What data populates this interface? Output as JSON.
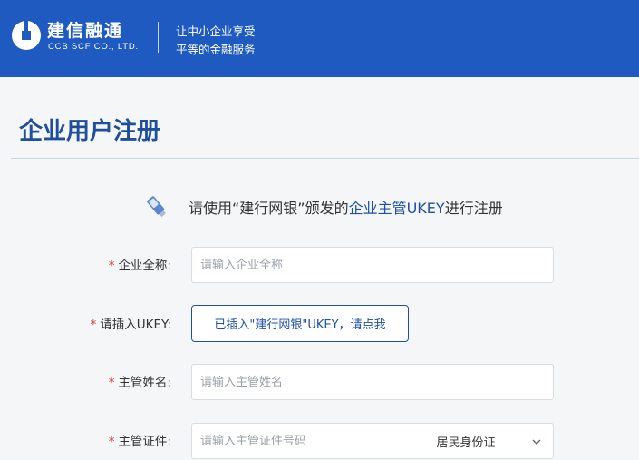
{
  "header": {
    "logo_cn": "建信融通",
    "logo_en": "CCB SCF CO., LTD.",
    "slogan_line1": "让中小企业享受",
    "slogan_line2": "平等的金融服务",
    "background_color": "#1e5ac0"
  },
  "page": {
    "title": "企业用户注册"
  },
  "notice": {
    "icon": "usb-key-icon",
    "prefix": "请使用“建行网银”颁发的",
    "highlight": "企业主管UKEY",
    "suffix": "进行注册"
  },
  "form": {
    "required_mark": "*",
    "company_name": {
      "label": "企业全称:",
      "placeholder": "请输入企业全称",
      "value": ""
    },
    "ukey": {
      "label": "请插入UKEY:",
      "button_label": "已插入\"建行网银\"UKEY，请点我"
    },
    "manager_name": {
      "label": "主管姓名:",
      "placeholder": "请输入主管姓名",
      "value": ""
    },
    "manager_id": {
      "label": "主管证件:",
      "placeholder": "请输入主管证件号码",
      "value": "",
      "id_type_selected": "居民身份证"
    }
  },
  "colors": {
    "accent": "#1e4fa8",
    "required": "#d9322a"
  }
}
